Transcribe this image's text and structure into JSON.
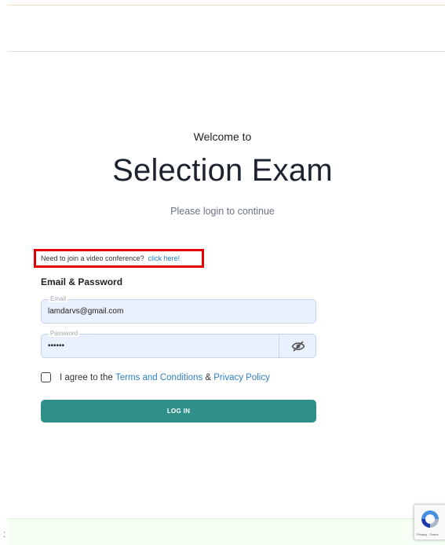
{
  "header": {
    "welcome": "Welcome to",
    "title": "Selection Exam",
    "subtitle": "Please login to continue"
  },
  "conference": {
    "text": "Need to join a video conference?",
    "link": "click here!"
  },
  "form": {
    "section_label": "Email & Password",
    "email": {
      "label": "Email",
      "value": "lamdarvs@gmail.com"
    },
    "password": {
      "label": "Password",
      "value": "••••••"
    },
    "agree": {
      "prefix": "I agree to the ",
      "terms": "Terms and Conditions",
      "and": " & ",
      "privacy": "Privacy Policy"
    },
    "login": "LOG IN"
  },
  "recaptcha": {
    "text": "Privacy - Terms"
  },
  "footer": {
    "glyph": "⁚"
  },
  "colors": {
    "accent": "#2e9089",
    "link": "#2e80c3",
    "highlight": "#e00000",
    "field_bg": "#e9f0fe"
  },
  "icons": {
    "password_toggle": "eye-slash-icon",
    "recaptcha": "recaptcha-logo-icon"
  }
}
